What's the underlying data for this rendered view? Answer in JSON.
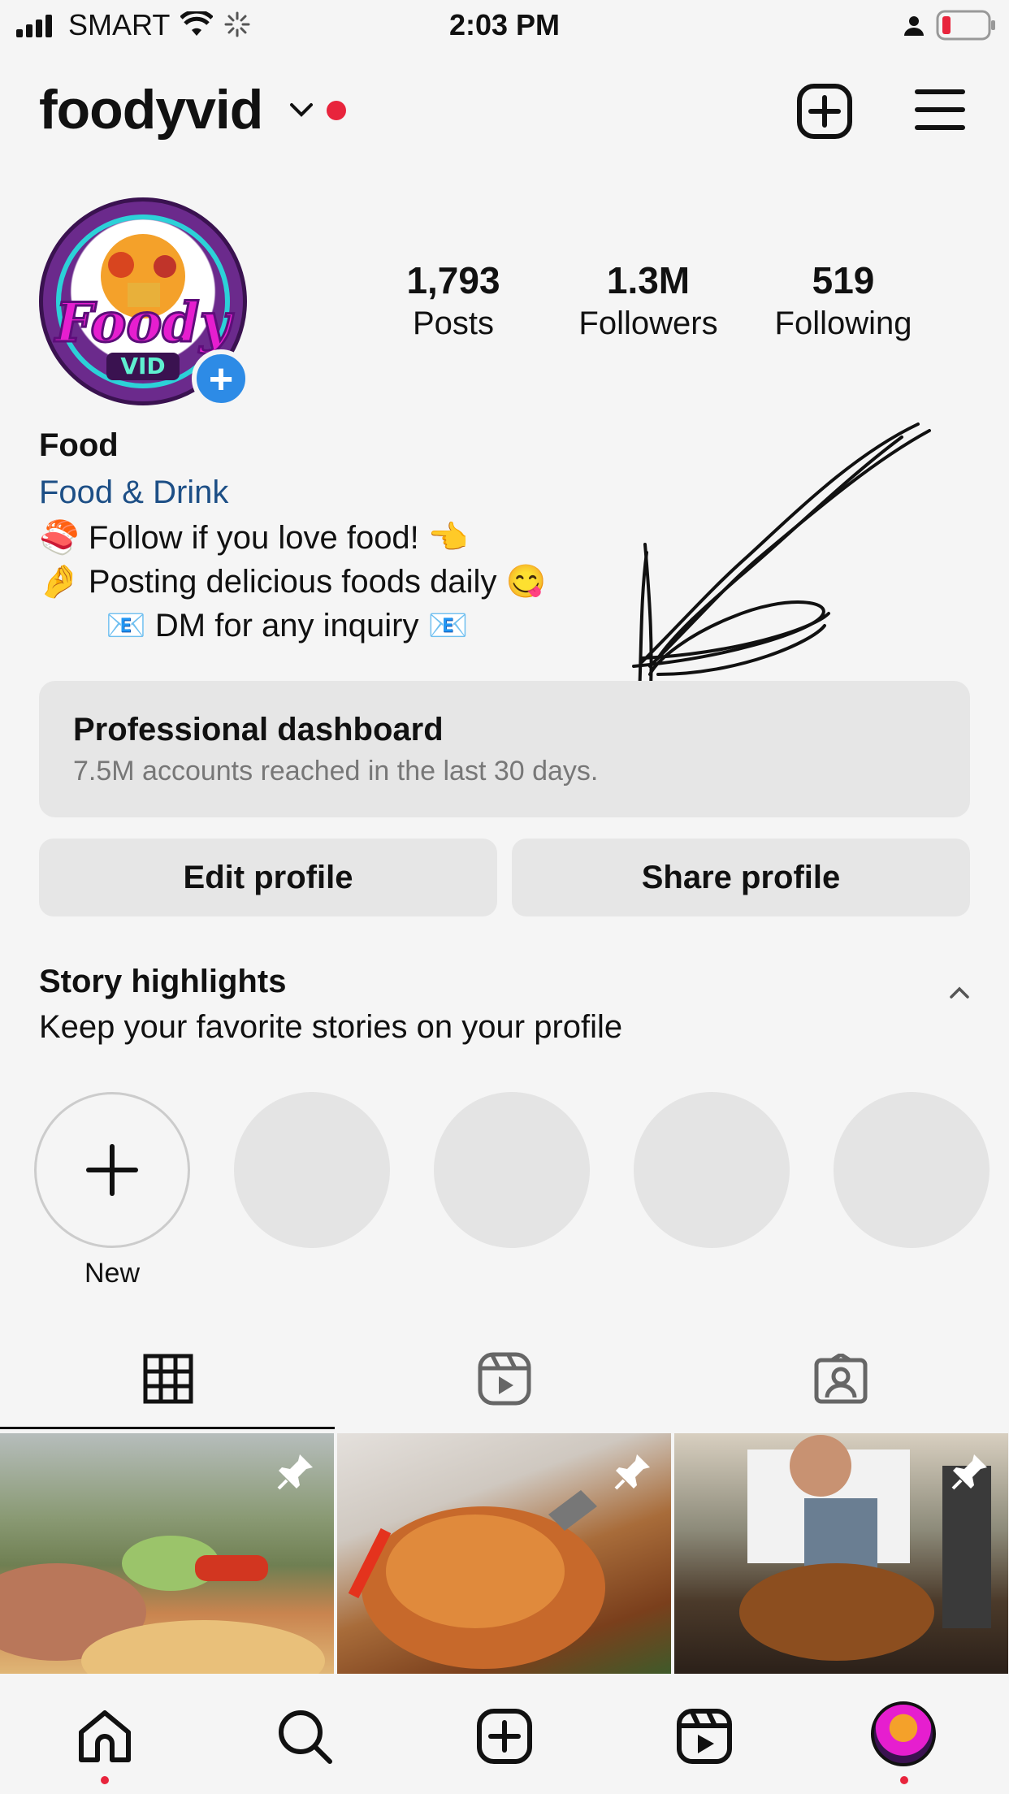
{
  "status_bar": {
    "carrier": "SMART",
    "time": "2:03 PM"
  },
  "header": {
    "username": "foodyvid"
  },
  "profile": {
    "avatar_text": "Foody VID",
    "stats": [
      {
        "value": "1,793",
        "label": "Posts"
      },
      {
        "value": "1.3M",
        "label": "Followers"
      },
      {
        "value": "519",
        "label": "Following"
      }
    ],
    "name": "Food",
    "category": "Food & Drink",
    "bio_lines": [
      "🍣 Follow if you love food! 👈",
      "🤌 Posting delicious foods daily 😋",
      "📧  DM for any inquiry 📧"
    ]
  },
  "dashboard": {
    "title": "Professional dashboard",
    "subtitle": "7.5M accounts reached in the last 30 days."
  },
  "buttons": {
    "edit": "Edit profile",
    "share": "Share profile"
  },
  "highlights": {
    "title": "Story highlights",
    "subtitle": "Keep your favorite stories on your profile",
    "new_label": "New"
  },
  "colors": {
    "link": "#1d4f86",
    "accent_blue": "#2d8be6",
    "notification_red": "#e8243c"
  }
}
